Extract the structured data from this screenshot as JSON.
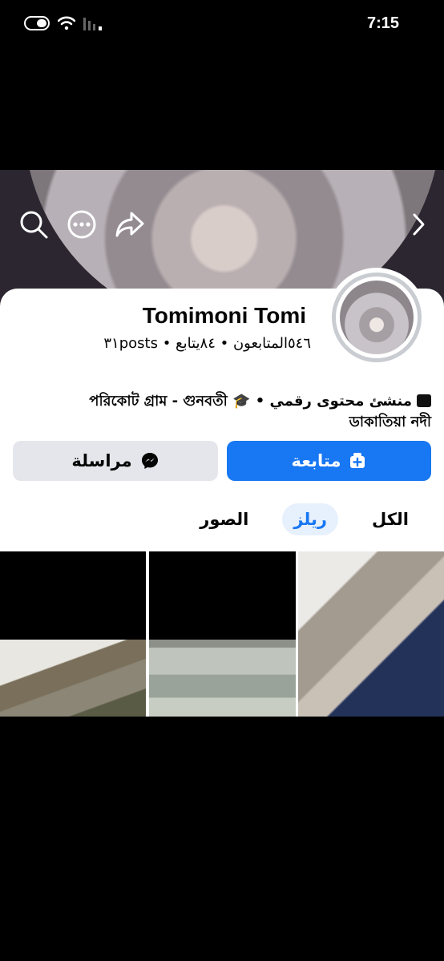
{
  "status_bar": {
    "time": "7:15"
  },
  "cover": {
    "icons": [
      "search-icon",
      "more-icon",
      "share-icon",
      "chevron-right-icon"
    ]
  },
  "profile": {
    "name": "Tomimoni Tomi",
    "stats": "٥٤٦المتابعون • ٨٤يتابع • ٣١posts",
    "bio_line1": "منشئ محتوى رقمي • 🎓 পরিকোট গ্রাম - গুনবতী",
    "bio_line2": "ডাকাতিয়া নদী"
  },
  "buttons": {
    "follow_label": "متابعة",
    "message_label": "مراسلة"
  },
  "tabs": [
    {
      "label": "الكل",
      "active": false
    },
    {
      "label": "ريلز",
      "active": true
    },
    {
      "label": "الصور",
      "active": false
    }
  ],
  "colors": {
    "accent": "#1877f2",
    "tab_active_bg": "#e7f0fd"
  }
}
